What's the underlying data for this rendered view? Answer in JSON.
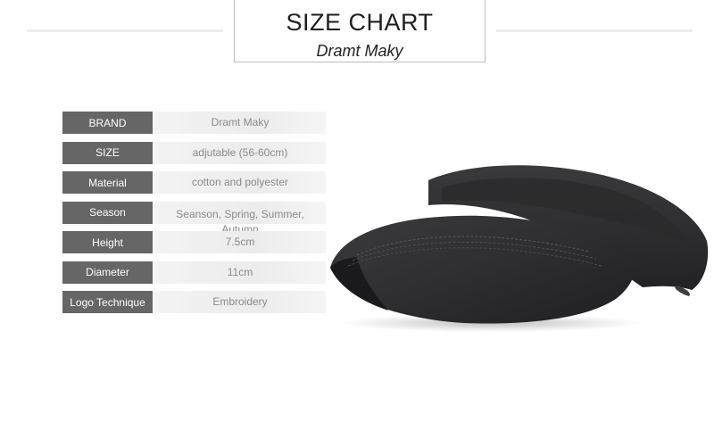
{
  "header": {
    "title": "SIZE CHART",
    "brand_name": "Dramt Maky"
  },
  "spec_rows": [
    {
      "label": "BRAND",
      "value": "Dramt Maky"
    },
    {
      "label": "SIZE",
      "value": "adjutable (56-60cm)"
    },
    {
      "label": "Material",
      "value": "cotton and polyester"
    },
    {
      "label": "Season",
      "value": "Seanson, Spring, Summer, Autumn"
    },
    {
      "label": "Height",
      "value": "7.5cm"
    },
    {
      "label": "Diameter",
      "value": "11cm"
    },
    {
      "label": "Logo Technique",
      "value": "Embroidery"
    }
  ],
  "colors": {
    "label_bg": "#666666",
    "value_bg": "#efefef",
    "hat": "#2b2b2d"
  }
}
